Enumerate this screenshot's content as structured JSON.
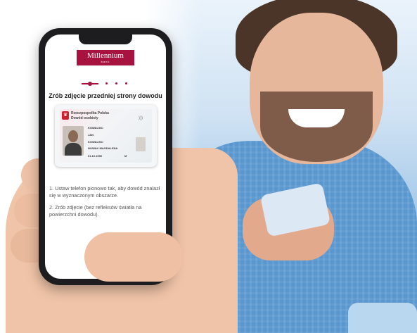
{
  "app": {
    "brand_name": "Millennium",
    "brand_sub": "bank",
    "accent_color": "#a8123e"
  },
  "progress": {
    "current_step": 1,
    "total_steps": 4
  },
  "screen": {
    "title": "Zrób zdjęcie przedniej strony dowodu",
    "instructions": [
      "1. Ustaw telefon pionowo tak, aby dowód znalazł się w wyznaczonym obszarze.",
      "2. Zrób zdjęcie (bez refleksów światła na powierzchni dowodu)."
    ],
    "capture_button_icon": "camera-icon"
  },
  "id_card": {
    "country": "Rzeczpospolita Polska",
    "document_type": "Dowód osobisty",
    "surname": "KOWALSKI",
    "given_name": "JAN",
    "parents_name": "KOWALSKI",
    "mother_maiden": "NOWAK MAGDALENA",
    "birth_date": "01.10.1990",
    "sex": "M"
  }
}
